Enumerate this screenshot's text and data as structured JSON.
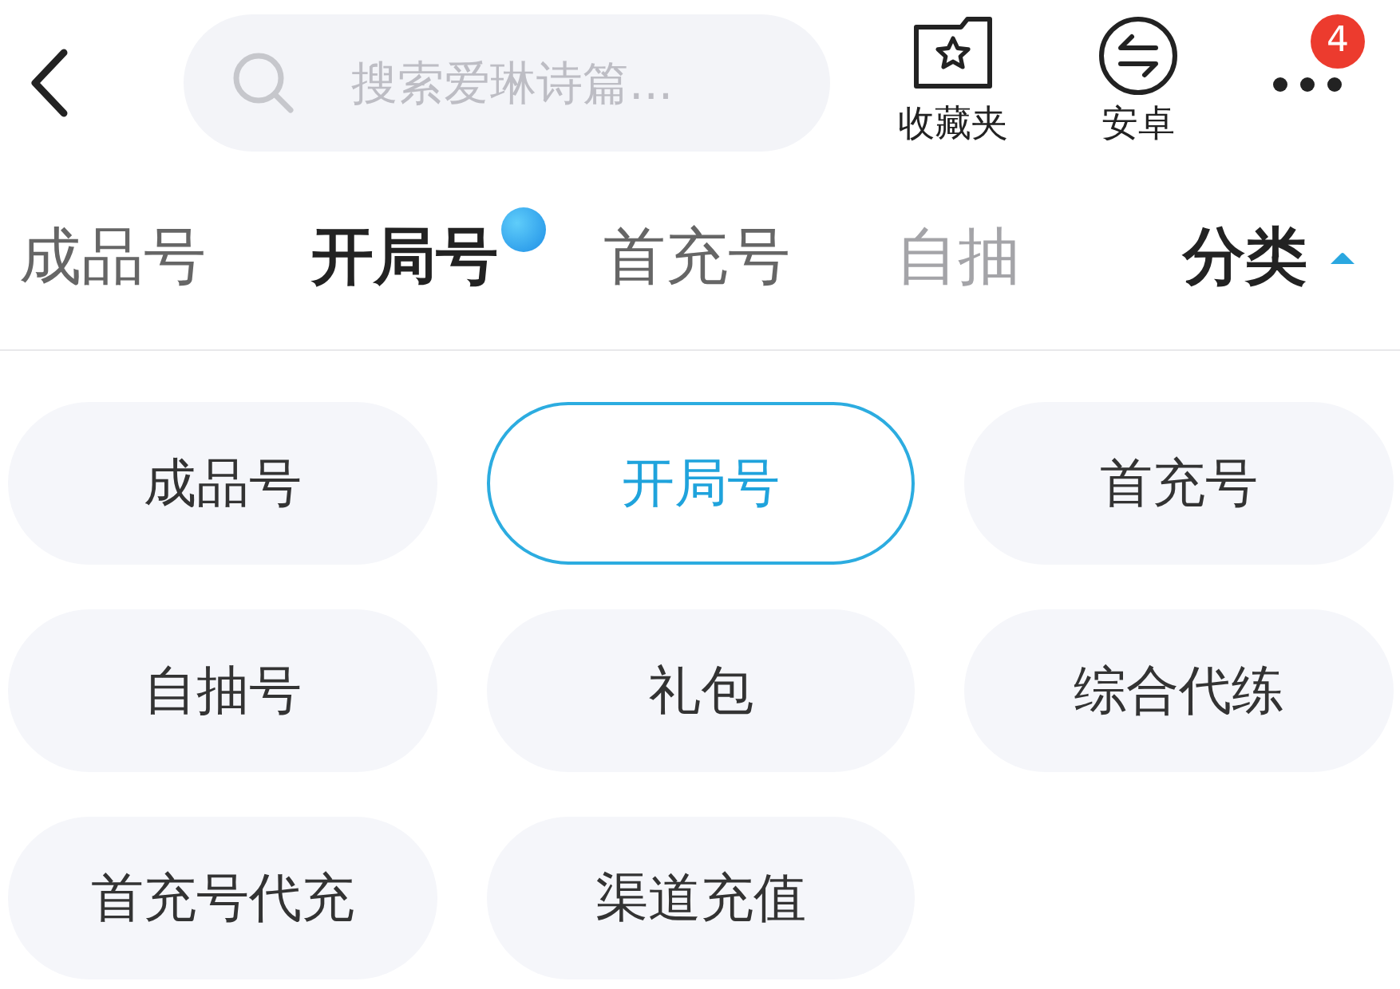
{
  "header": {
    "search": {
      "placeholder": "搜索爱琳诗篇..."
    },
    "actions": [
      {
        "kind": "favorites",
        "label": "收藏夹"
      },
      {
        "kind": "platform",
        "label": "安卓"
      }
    ],
    "more": {
      "badge": "4"
    }
  },
  "tabs": [
    {
      "label": "成品号",
      "selected": false,
      "dot": false,
      "faded": false
    },
    {
      "label": "开局号",
      "selected": true,
      "dot": true,
      "faded": false
    },
    {
      "label": "首充号",
      "selected": false,
      "dot": false,
      "faded": false
    },
    {
      "label": "自抽",
      "selected": false,
      "dot": false,
      "faded": true
    }
  ],
  "category_toggle": {
    "label": "分类",
    "expanded": true
  },
  "categories": [
    {
      "label": "成品号",
      "selected": false
    },
    {
      "label": "开局号",
      "selected": true
    },
    {
      "label": "首充号",
      "selected": false
    },
    {
      "label": "自抽号",
      "selected": false
    },
    {
      "label": "礼包",
      "selected": false
    },
    {
      "label": "综合代练",
      "selected": false
    },
    {
      "label": "首充号代充",
      "selected": false
    },
    {
      "label": "渠道充值",
      "selected": false
    }
  ]
}
